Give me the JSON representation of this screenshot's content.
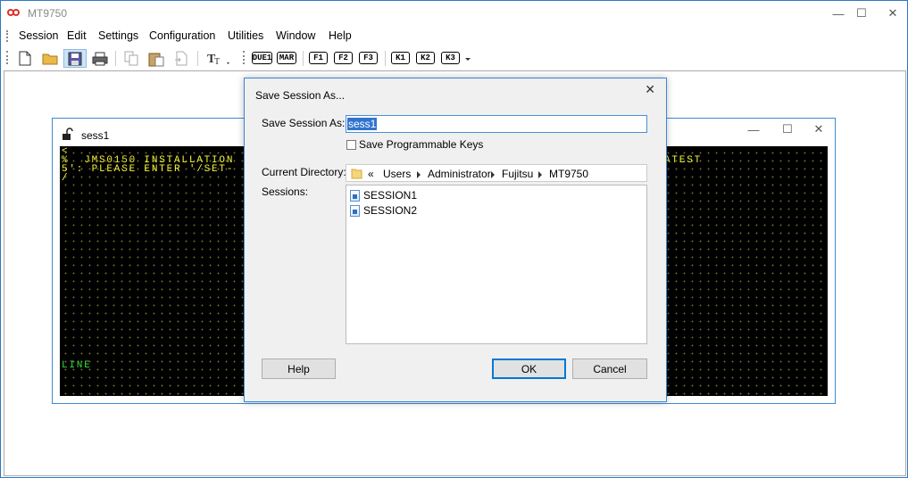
{
  "app": {
    "title": "MT9750",
    "icon": "infinity-logo-icon",
    "brand_color": "#e0322a"
  },
  "window_controls": {
    "minimize": "—",
    "maximize": "☐",
    "close": "✕"
  },
  "menu": [
    "Session",
    "Edit",
    "Settings",
    "Configuration",
    "Utilities",
    "Window",
    "Help"
  ],
  "toolbar": {
    "icons": [
      "new-file-icon",
      "open-folder-icon",
      "save-icon",
      "print-icon",
      "copy-icon",
      "paste-icon",
      "paste-special-icon",
      "font-icon"
    ],
    "keys": [
      "DUE1",
      "MAR",
      "F1",
      "F2",
      "F3",
      "K1",
      "K2",
      "K3"
    ]
  },
  "session_window": {
    "title": "sess1",
    "terminal_lines": [
      "<",
      "%  JMS0150 INSTALLATION",
      "5': PLEASE ENTER '/SET-",
      "/"
    ],
    "terminal_right_fragment": "ATEST",
    "status_line": "LINE",
    "controls": {
      "minimize": "—",
      "maximize": "☐",
      "close": "✕"
    }
  },
  "dialog": {
    "title": "Save Session As...",
    "close": "✕",
    "save_as_label": "Save Session As:",
    "save_as_value": "sess1",
    "checkbox_label": "Save Programmable Keys",
    "checkbox_checked": false,
    "current_dir_label": "Current Directory:",
    "path_prefix": "«",
    "path": [
      "Users",
      "Administrator",
      "Fujitsu",
      "MT9750"
    ],
    "sessions_label": "Sessions:",
    "sessions": [
      "SESSION1",
      "SESSION2"
    ],
    "help_button": "Help",
    "ok_button": "OK",
    "cancel_button": "Cancel"
  }
}
